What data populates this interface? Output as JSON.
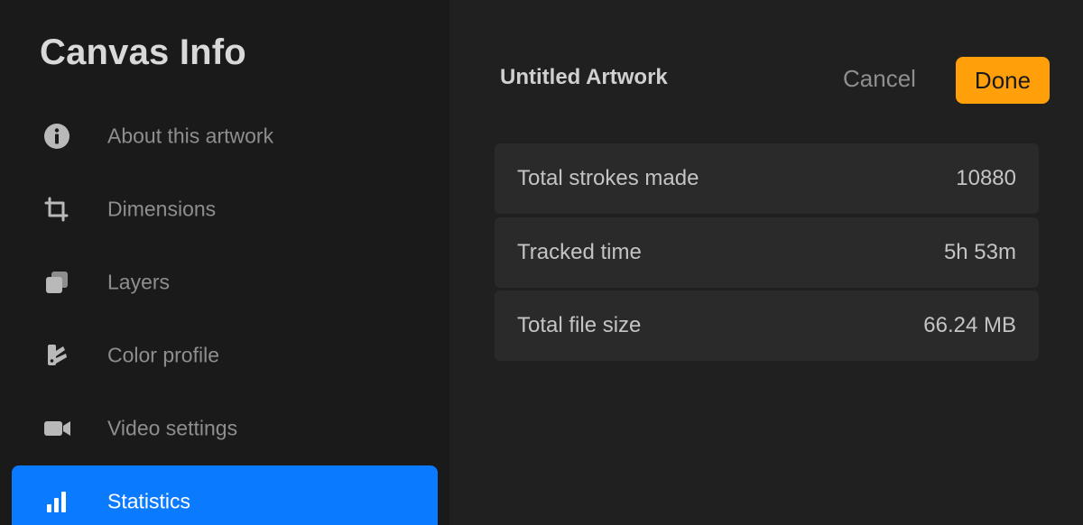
{
  "sidebar": {
    "title": "Canvas Info",
    "items": [
      {
        "label": "About this artwork",
        "icon": "info-icon"
      },
      {
        "label": "Dimensions",
        "icon": "crop-icon"
      },
      {
        "label": "Layers",
        "icon": "layers-icon"
      },
      {
        "label": "Color profile",
        "icon": "color-swatch-icon"
      },
      {
        "label": "Video settings",
        "icon": "video-camera-icon"
      },
      {
        "label": "Statistics",
        "icon": "bar-chart-icon",
        "active": true
      }
    ]
  },
  "main": {
    "title": "Untitled Artwork",
    "cancel_label": "Cancel",
    "done_label": "Done",
    "stats": [
      {
        "label": "Total strokes made",
        "value": "10880"
      },
      {
        "label": "Tracked time",
        "value": "5h 53m"
      },
      {
        "label": "Total file size",
        "value": "66.24 MB"
      }
    ]
  },
  "colors": {
    "sidebar_bg": "#1a1a1a",
    "main_bg": "#202020",
    "row_bg": "#2a2a2a",
    "accent_blue": "#0a7aff",
    "accent_orange": "#ff9f0a"
  }
}
